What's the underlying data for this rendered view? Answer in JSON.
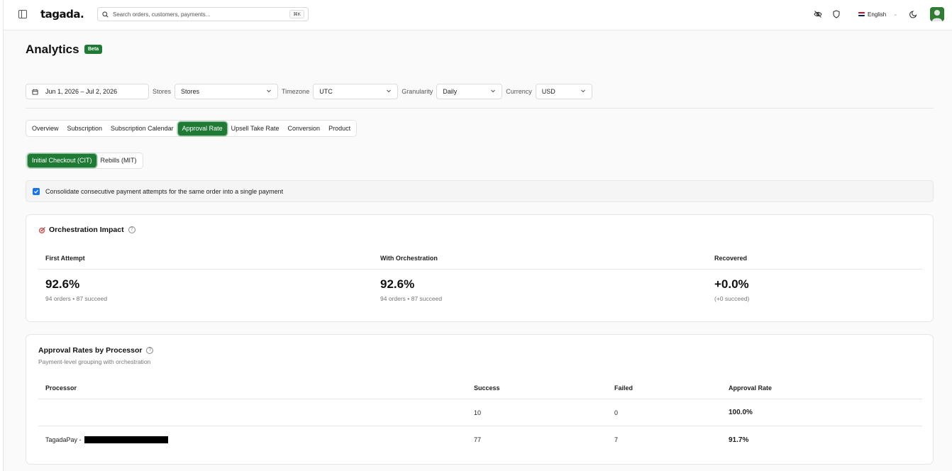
{
  "app": {
    "logo": "tagada."
  },
  "header": {
    "search_placeholder": "Search orders, customers, payments...",
    "search_shortcut": "⌘K",
    "language": "English",
    "icons": [
      "sidebar-toggle-icon",
      "eye-off-icon",
      "shield-icon",
      "flag-uk-icon",
      "moon-icon",
      "avatar"
    ]
  },
  "page": {
    "title": "Analytics",
    "badge": "Beta"
  },
  "filters": {
    "date_range": "Jun 1, 2026 – Jul 2, 2026",
    "stores_label": "Stores",
    "stores_value": "Stores",
    "timezone_label": "Timezone",
    "timezone_value": "UTC",
    "granularity_label": "Granularity",
    "granularity_value": "Daily",
    "currency_label": "Currency",
    "currency_value": "USD"
  },
  "tabs": [
    {
      "label": "Overview",
      "active": false
    },
    {
      "label": "Subscription",
      "active": false
    },
    {
      "label": "Subscription Calendar",
      "active": false
    },
    {
      "label": "Approval Rate",
      "active": true
    },
    {
      "label": "Upsell Take Rate",
      "active": false
    },
    {
      "label": "Conversion",
      "active": false
    },
    {
      "label": "Product",
      "active": false
    }
  ],
  "subtabs": [
    {
      "label": "Initial Checkout (CIT)",
      "active": true
    },
    {
      "label": "Rebills (MIT)",
      "active": false
    }
  ],
  "consolidate": {
    "checked": true,
    "label": "Consolidate consecutive payment attempts for the same order into a single payment"
  },
  "orchestration": {
    "title": "Orchestration Impact",
    "metrics": [
      {
        "label": "First Attempt",
        "value": "92.6%",
        "sub": "94 orders • 87 succeed"
      },
      {
        "label": "With Orchestration",
        "value": "92.6%",
        "sub": "94 orders • 87 succeed"
      },
      {
        "label": "Recovered",
        "value": "+0.0%",
        "sub": "(+0 succeed)"
      }
    ]
  },
  "processors": {
    "title": "Approval Rates by Processor",
    "subtitle": "Payment-level grouping with orchestration",
    "columns": [
      "Processor",
      "Success",
      "Failed",
      "Approval Rate"
    ],
    "rows": [
      {
        "processor": "",
        "success": "10",
        "failed": "0",
        "rate": "100.0%"
      },
      {
        "processor": "TagadaPay -",
        "success": "77",
        "failed": "7",
        "rate": "91.7%"
      }
    ]
  }
}
